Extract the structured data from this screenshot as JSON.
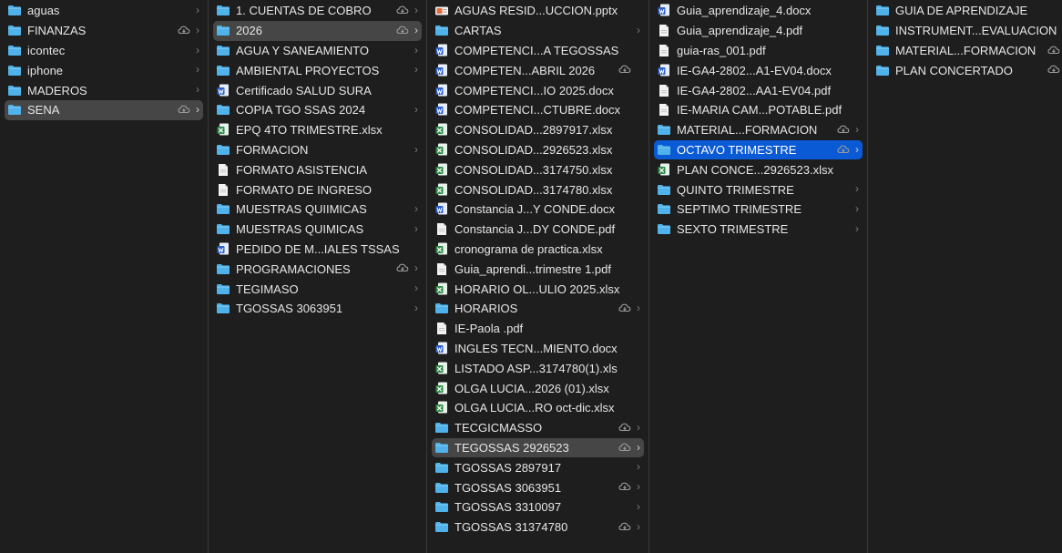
{
  "colors": {
    "background": "#1e1e1e",
    "folder": "#4fb2ea",
    "selection_active": "#0a5ad5",
    "selection_inactive": "#464646",
    "word": "#2b5ec9",
    "excel": "#2e8b47",
    "pptx": "#e46c3a"
  },
  "columns": [
    {
      "items": [
        {
          "label": "aguas",
          "icon": "folder-icon",
          "cloud": false,
          "chevron": true,
          "selected": ""
        },
        {
          "label": "FINANZAS",
          "icon": "folder-icon",
          "cloud": true,
          "chevron": true,
          "selected": ""
        },
        {
          "label": "icontec",
          "icon": "folder-icon",
          "cloud": false,
          "chevron": true,
          "selected": ""
        },
        {
          "label": "iphone",
          "icon": "folder-icon",
          "cloud": false,
          "chevron": true,
          "selected": ""
        },
        {
          "label": "MADEROS",
          "icon": "folder-icon",
          "cloud": false,
          "chevron": true,
          "selected": ""
        },
        {
          "label": "SENA",
          "icon": "folder-icon",
          "cloud": true,
          "chevron": true,
          "selected": "gray"
        }
      ]
    },
    {
      "items": [
        {
          "label": "1. CUENTAS DE COBRO",
          "icon": "folder-icon",
          "cloud": true,
          "chevron": true,
          "selected": ""
        },
        {
          "label": "2026",
          "icon": "folder-icon",
          "cloud": true,
          "chevron": true,
          "selected": "gray"
        },
        {
          "label": "AGUA Y SANEAMIENTO",
          "icon": "folder-icon",
          "cloud": false,
          "chevron": true,
          "selected": ""
        },
        {
          "label": "AMBIENTAL PROYECTOS",
          "icon": "folder-icon",
          "cloud": false,
          "chevron": true,
          "selected": ""
        },
        {
          "label": "Certificado SALUD SURA",
          "icon": "word-doc-icon",
          "cloud": false,
          "chevron": false,
          "selected": ""
        },
        {
          "label": "COPIA TGO SSAS 2024",
          "icon": "folder-icon",
          "cloud": false,
          "chevron": true,
          "selected": ""
        },
        {
          "label": "EPQ 4TO TRIMESTRE.xlsx",
          "icon": "excel-doc-icon",
          "cloud": false,
          "chevron": false,
          "selected": ""
        },
        {
          "label": "FORMACION",
          "icon": "folder-icon",
          "cloud": false,
          "chevron": true,
          "selected": ""
        },
        {
          "label": "FORMATO ASISTENCIA",
          "icon": "generic-doc-icon",
          "cloud": false,
          "chevron": false,
          "selected": ""
        },
        {
          "label": "FORMATO DE INGRESO",
          "icon": "generic-doc-icon",
          "cloud": false,
          "chevron": false,
          "selected": ""
        },
        {
          "label": "MUESTRAS QUIIMICAS",
          "icon": "folder-icon",
          "cloud": false,
          "chevron": true,
          "selected": ""
        },
        {
          "label": "MUESTRAS QUIMICAS",
          "icon": "folder-icon",
          "cloud": false,
          "chevron": true,
          "selected": ""
        },
        {
          "label": "PEDIDO DE M...IALES TSSAS",
          "icon": "word-doc-icon",
          "cloud": false,
          "chevron": false,
          "selected": ""
        },
        {
          "label": "PROGRAMACIONES",
          "icon": "folder-icon",
          "cloud": true,
          "chevron": true,
          "selected": ""
        },
        {
          "label": "TEGIMASO",
          "icon": "folder-icon",
          "cloud": false,
          "chevron": true,
          "selected": ""
        },
        {
          "label": "TGOSSAS 3063951",
          "icon": "folder-icon",
          "cloud": false,
          "chevron": true,
          "selected": ""
        }
      ]
    },
    {
      "items": [
        {
          "label": "AGUAS RESID...UCCION.pptx",
          "icon": "pptx-doc-icon",
          "cloud": false,
          "chevron": false,
          "selected": ""
        },
        {
          "label": "CARTAS",
          "icon": "folder-icon",
          "cloud": false,
          "chevron": true,
          "selected": ""
        },
        {
          "label": "COMPETENCI...A TEGOSSAS",
          "icon": "word-doc-icon",
          "cloud": false,
          "chevron": false,
          "selected": ""
        },
        {
          "label": "COMPETEN...ABRIL 2026",
          "icon": "word-doc-icon",
          "cloud": true,
          "chevron": false,
          "selected": ""
        },
        {
          "label": "COMPETENCI...IO 2025.docx",
          "icon": "word-doc-icon",
          "cloud": false,
          "chevron": false,
          "selected": ""
        },
        {
          "label": "COMPETENCI...CTUBRE.docx",
          "icon": "word-doc-icon",
          "cloud": false,
          "chevron": false,
          "selected": ""
        },
        {
          "label": "CONSOLIDAD...2897917.xlsx",
          "icon": "excel-doc-icon",
          "cloud": false,
          "chevron": false,
          "selected": ""
        },
        {
          "label": "CONSOLIDAD...2926523.xlsx",
          "icon": "excel-doc-icon",
          "cloud": false,
          "chevron": false,
          "selected": ""
        },
        {
          "label": "CONSOLIDAD...3174750.xlsx",
          "icon": "excel-doc-icon",
          "cloud": false,
          "chevron": false,
          "selected": ""
        },
        {
          "label": "CONSOLIDAD...3174780.xlsx",
          "icon": "excel-doc-icon",
          "cloud": false,
          "chevron": false,
          "selected": ""
        },
        {
          "label": "Constancia J...Y CONDE.docx",
          "icon": "word-doc-icon",
          "cloud": false,
          "chevron": false,
          "selected": ""
        },
        {
          "label": "Constancia J...DY CONDE.pdf",
          "icon": "generic-doc-icon",
          "cloud": false,
          "chevron": false,
          "selected": ""
        },
        {
          "label": "cronograma de practica.xlsx",
          "icon": "excel-doc-icon",
          "cloud": false,
          "chevron": false,
          "selected": ""
        },
        {
          "label": "Guia_aprendi...trimestre 1.pdf",
          "icon": "generic-doc-icon",
          "cloud": false,
          "chevron": false,
          "selected": ""
        },
        {
          "label": "HORARIO OL...ULIO 2025.xlsx",
          "icon": "excel-doc-icon",
          "cloud": false,
          "chevron": false,
          "selected": ""
        },
        {
          "label": "HORARIOS",
          "icon": "folder-icon",
          "cloud": true,
          "chevron": true,
          "selected": ""
        },
        {
          "label": "IE-Paola .pdf",
          "icon": "generic-doc-icon",
          "cloud": false,
          "chevron": false,
          "selected": ""
        },
        {
          "label": "INGLES TECN...MIENTO.docx",
          "icon": "word-doc-icon",
          "cloud": false,
          "chevron": false,
          "selected": ""
        },
        {
          "label": "LISTADO ASP...3174780(1).xls",
          "icon": "excel-doc-icon",
          "cloud": false,
          "chevron": false,
          "selected": ""
        },
        {
          "label": "OLGA LUCIA...2026 (01).xlsx",
          "icon": "excel-doc-icon",
          "cloud": false,
          "chevron": false,
          "selected": ""
        },
        {
          "label": "OLGA LUCIA...RO oct-dic.xlsx",
          "icon": "excel-doc-icon",
          "cloud": false,
          "chevron": false,
          "selected": ""
        },
        {
          "label": "TECGICMASSO",
          "icon": "folder-icon",
          "cloud": true,
          "chevron": true,
          "selected": ""
        },
        {
          "label": "TEGOSSAS 2926523",
          "icon": "folder-icon",
          "cloud": true,
          "chevron": true,
          "selected": "gray"
        },
        {
          "label": "TGOSSAS 2897917",
          "icon": "folder-icon",
          "cloud": false,
          "chevron": true,
          "selected": ""
        },
        {
          "label": "TGOSSAS 3063951",
          "icon": "folder-icon",
          "cloud": true,
          "chevron": true,
          "selected": ""
        },
        {
          "label": "TGOSSAS 3310097",
          "icon": "folder-icon",
          "cloud": false,
          "chevron": true,
          "selected": ""
        },
        {
          "label": "TGOSSAS 31374780",
          "icon": "folder-icon",
          "cloud": true,
          "chevron": true,
          "selected": ""
        }
      ]
    },
    {
      "items": [
        {
          "label": "Guia_aprendizaje_4.docx",
          "icon": "word-doc-icon",
          "cloud": false,
          "chevron": false,
          "selected": ""
        },
        {
          "label": "Guia_aprendizaje_4.pdf",
          "icon": "generic-doc-icon",
          "cloud": false,
          "chevron": false,
          "selected": ""
        },
        {
          "label": "guia-ras_001.pdf",
          "icon": "generic-doc-icon",
          "cloud": false,
          "chevron": false,
          "selected": ""
        },
        {
          "label": "IE-GA4-2802...A1-EV04.docx",
          "icon": "word-doc-icon",
          "cloud": false,
          "chevron": false,
          "selected": ""
        },
        {
          "label": "IE-GA4-2802...AA1-EV04.pdf",
          "icon": "generic-doc-icon",
          "cloud": false,
          "chevron": false,
          "selected": ""
        },
        {
          "label": "IE-MARIA CAM...POTABLE.pdf",
          "icon": "generic-doc-icon",
          "cloud": false,
          "chevron": false,
          "selected": ""
        },
        {
          "label": "MATERIAL...FORMACION",
          "icon": "folder-icon",
          "cloud": true,
          "chevron": true,
          "selected": ""
        },
        {
          "label": "OCTAVO TRIMESTRE",
          "icon": "folder-icon",
          "cloud": true,
          "chevron": true,
          "selected": "blue"
        },
        {
          "label": "PLAN CONCE...2926523.xlsx",
          "icon": "excel-doc-icon",
          "cloud": false,
          "chevron": false,
          "selected": ""
        },
        {
          "label": "QUINTO TRIMESTRE",
          "icon": "folder-icon",
          "cloud": false,
          "chevron": true,
          "selected": ""
        },
        {
          "label": "SEPTIMO TRIMESTRE",
          "icon": "folder-icon",
          "cloud": false,
          "chevron": true,
          "selected": ""
        },
        {
          "label": "SEXTO TRIMESTRE",
          "icon": "folder-icon",
          "cloud": false,
          "chevron": true,
          "selected": ""
        }
      ]
    },
    {
      "items": [
        {
          "label": "GUIA DE APRENDIZAJE",
          "icon": "folder-icon",
          "cloud": false,
          "chevron": false,
          "selected": ""
        },
        {
          "label": "INSTRUMENT...EVALUACION",
          "icon": "folder-icon",
          "cloud": false,
          "chevron": false,
          "selected": ""
        },
        {
          "label": "MATERIAL...FORMACION",
          "icon": "folder-icon",
          "cloud": true,
          "chevron": false,
          "selected": ""
        },
        {
          "label": "PLAN CONCERTADO",
          "icon": "folder-icon",
          "cloud": true,
          "chevron": false,
          "selected": ""
        }
      ]
    }
  ]
}
